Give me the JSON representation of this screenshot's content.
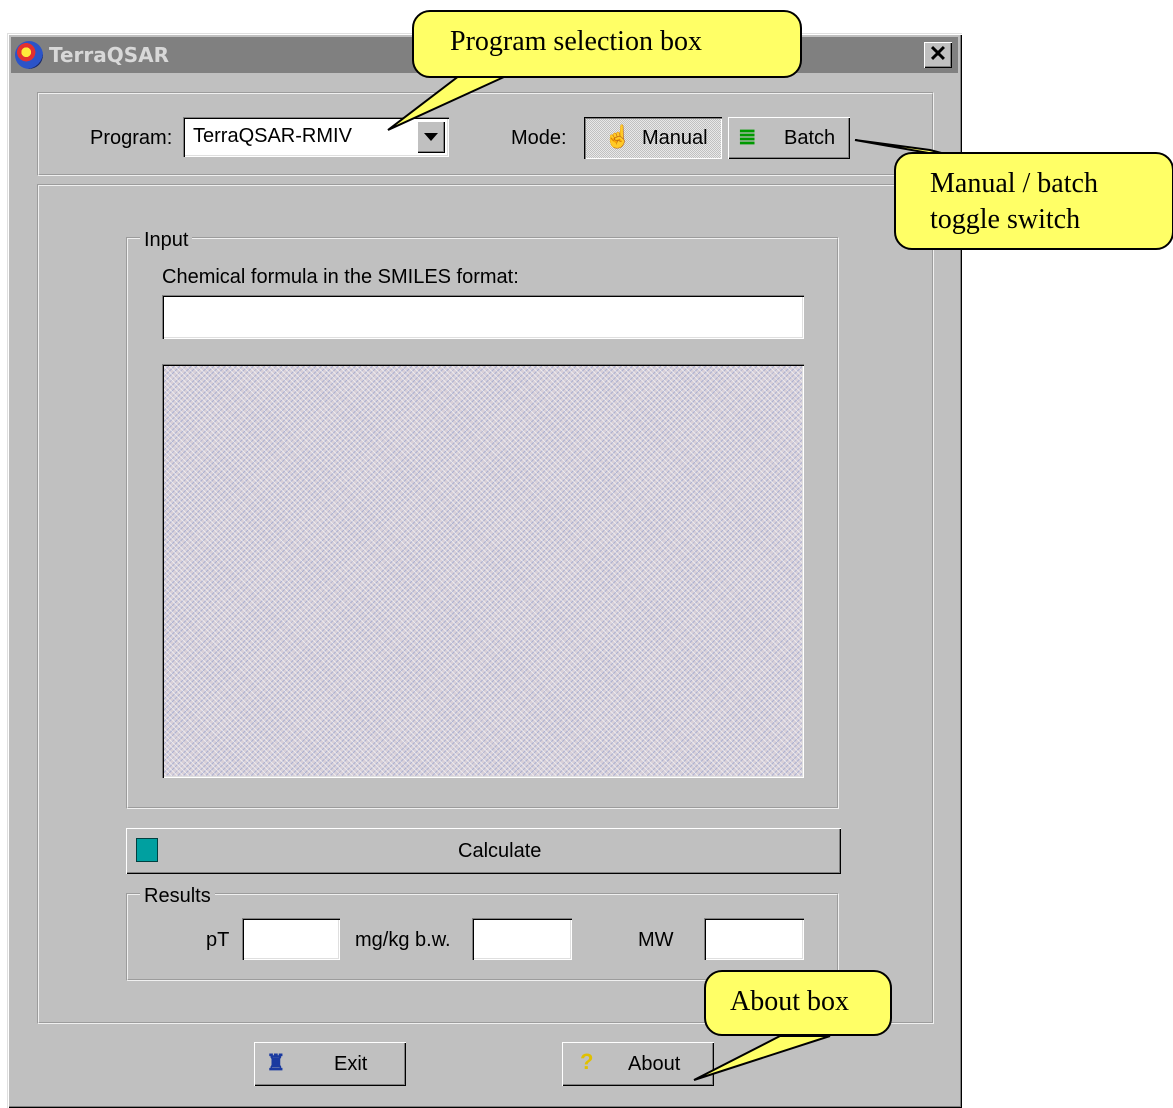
{
  "window": {
    "title": "TerraQSAR"
  },
  "program": {
    "label": "Program:",
    "selected": "TerraQSAR-RMIV"
  },
  "mode": {
    "label": "Mode:",
    "manual_label": "Manual",
    "batch_label": "Batch",
    "active": "Manual"
  },
  "input": {
    "group_label": "Input",
    "smiles_label": "Chemical formula in the SMILES format:",
    "smiles_value": ""
  },
  "calculate": {
    "label": "Calculate"
  },
  "results": {
    "group_label": "Results",
    "pt_label": "pT",
    "mgkg_label": "mg/kg b.w.",
    "mw_label": "MW",
    "pt_value": "",
    "mgkg_value": "",
    "mw_value": ""
  },
  "footer": {
    "exit_label": "Exit",
    "about_label": "About"
  },
  "callouts": {
    "program_selection": "Program selection box",
    "mode_toggle_line1": "Manual / batch",
    "mode_toggle_line2": "toggle switch",
    "about_box": "About box"
  },
  "colors": {
    "callout_fill": "#ffff66",
    "dialog_face": "#c0c0c0",
    "titlebar_inactive": "#808080"
  }
}
